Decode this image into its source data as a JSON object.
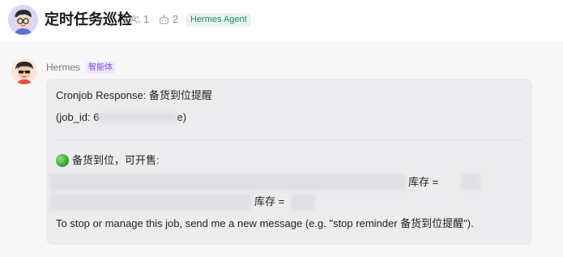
{
  "header": {
    "title": "定时任务巡检",
    "member_count": "1",
    "bot_count": "2",
    "tag": "Hermes Agent"
  },
  "message": {
    "sender": "Hermes",
    "sender_badge": "智能体",
    "line1": "Cronjob Response: 备货到位提醒",
    "job_prefix": "(job_id: 6",
    "job_suffix": "e)",
    "section_heading": "备货到位，可开售:",
    "item1_tail": "库存 =",
    "item2_tail": "库存 =",
    "footer": "To stop or manage this job, send me a new message (e.g. \"stop reminder 备货到位提醒\")."
  },
  "icons": {
    "members": "people-icon",
    "bots": "robot-icon",
    "status": "green-circle-icon"
  }
}
